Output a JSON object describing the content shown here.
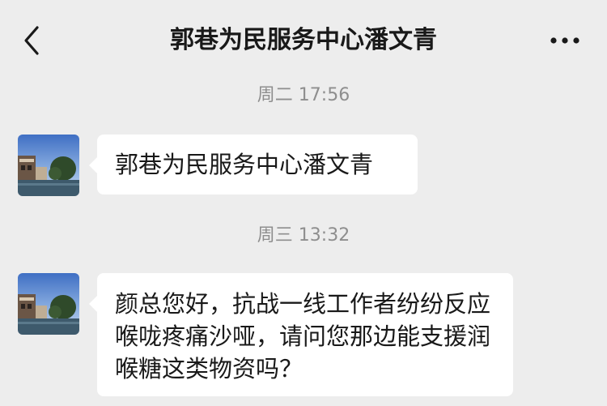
{
  "header": {
    "title": "郭巷为民服务中心潘文青",
    "back_icon": "chevron-left-icon",
    "more_icon": "more-dots-icon"
  },
  "messages": [
    {
      "timestamp": "周二 17:56",
      "text": "郭巷为民服务中心潘文青",
      "sender_avatar": "landscape-canal-avatar"
    },
    {
      "timestamp": "周三 13:32",
      "text": "颜总您好，抗战一线工作者纷纷反应喉咙疼痛沙哑，请问您那边能支援润喉糖这类物资吗？",
      "sender_avatar": "landscape-canal-avatar"
    }
  ],
  "colors": {
    "background": "#ededed",
    "bubble": "#ffffff",
    "timestamp": "#8e8e8e",
    "text": "#191919"
  }
}
